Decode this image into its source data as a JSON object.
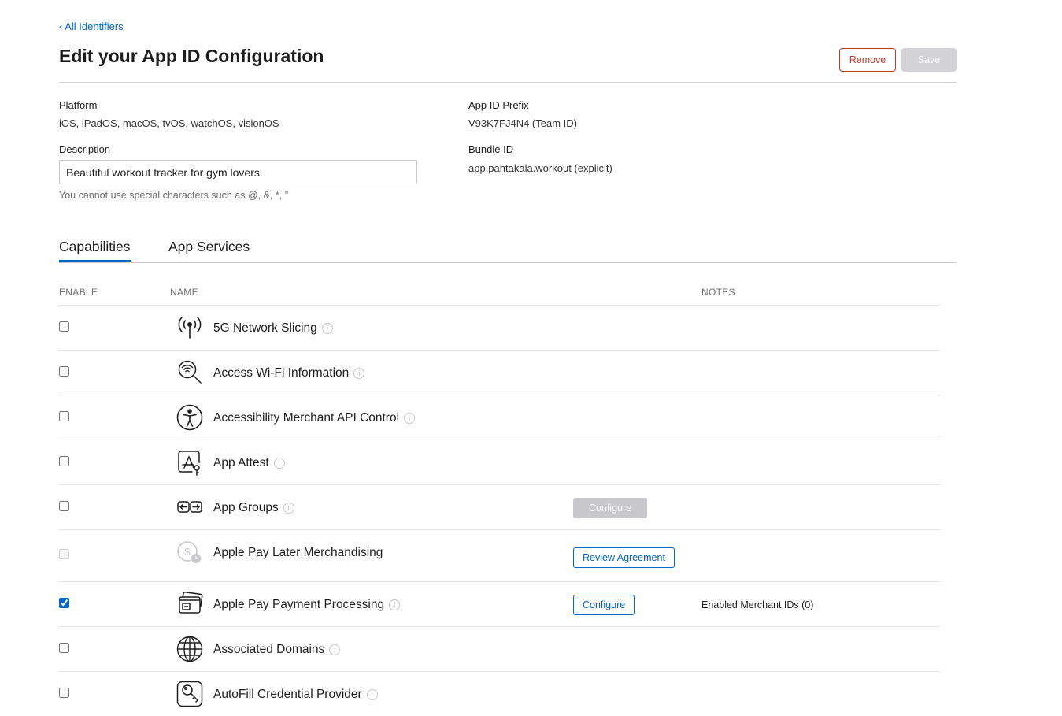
{
  "nav": {
    "back_label": "‹ All Identifiers"
  },
  "header": {
    "title": "Edit your App ID Configuration",
    "remove_label": "Remove",
    "save_label": "Save"
  },
  "details": {
    "platform_label": "Platform",
    "platform_value": "iOS, iPadOS, macOS, tvOS, watchOS, visionOS",
    "description_label": "Description",
    "description_value": "Beautiful workout tracker for gym lovers",
    "description_hint": "You cannot use special characters such as @, &, *, \"",
    "prefix_label": "App ID Prefix",
    "prefix_value": "V93K7FJ4N4 (Team ID)",
    "bundle_label": "Bundle ID",
    "bundle_value": "app.pantakala.workout (explicit)"
  },
  "tabs": [
    {
      "label": "Capabilities",
      "active": true
    },
    {
      "label": "App Services",
      "active": false
    }
  ],
  "columns": {
    "enable": "ENABLE",
    "name": "NAME",
    "notes": "NOTES"
  },
  "capabilities": [
    {
      "name": "5G Network Slicing",
      "icon": "antenna-icon",
      "checked": false
    },
    {
      "name": "Access Wi-Fi Information",
      "icon": "wifi-search-icon",
      "checked": false
    },
    {
      "name": "Accessibility Merchant API Control",
      "icon": "accessibility-icon",
      "checked": false
    },
    {
      "name": "App Attest",
      "icon": "app-attest-icon",
      "checked": false
    },
    {
      "name": "App Groups",
      "icon": "app-groups-icon",
      "checked": false,
      "button": "Configure"
    },
    {
      "name": "Apple Pay Later Merchandising",
      "icon": "pay-later-icon",
      "checked": false,
      "disabled": true,
      "button": "Review Agreement"
    },
    {
      "name": "Apple Pay Payment Processing",
      "icon": "apple-pay-card-icon",
      "checked": true,
      "button": "Configure",
      "note": "Enabled Merchant IDs (0)"
    },
    {
      "name": "Associated Domains",
      "icon": "globe-icon",
      "checked": false
    },
    {
      "name": "AutoFill Credential Provider",
      "icon": "key-icon",
      "checked": false
    }
  ],
  "colors": {
    "accent": "#0066cc",
    "danger": "#c9362a",
    "disabled": "#c7c7cc"
  }
}
